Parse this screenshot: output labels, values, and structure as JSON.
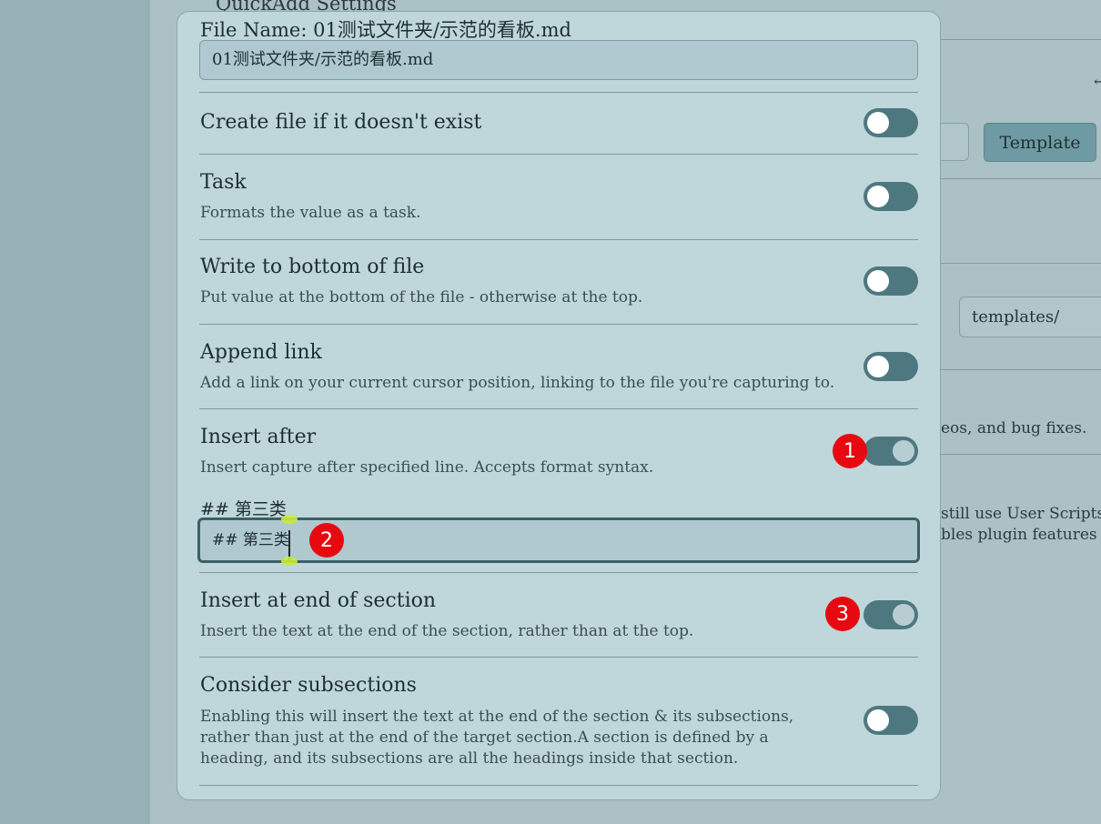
{
  "background": {
    "title": "QuickAdd Settings",
    "template_button": "Template",
    "templates_input_value": "templates/",
    "text_1": "eos, and bug fixes.",
    "text_2": "still use User Scripts",
    "text_3": "bles plugin features",
    "arrow_glyph": "←"
  },
  "modal": {
    "file_name_label": "File Name: 01测试文件夹/示范的看板.md",
    "file_name_value": "01测试文件夹/示范的看板.md",
    "settings": [
      {
        "title": "Create file if it doesn't exist",
        "desc": "",
        "enabled": false
      },
      {
        "title": "Task",
        "desc": "Formats the value as a task.",
        "enabled": false
      },
      {
        "title": "Write to bottom of file",
        "desc": "Put value at the bottom of the file - otherwise at the top.",
        "enabled": false
      },
      {
        "title": "Append link",
        "desc": "Add a link on your current cursor position, linking to the file you're capturing to.",
        "enabled": false
      },
      {
        "title": "Insert after",
        "desc": "Insert capture after specified line. Accepts format syntax.",
        "enabled": true
      },
      {
        "title": "Insert at end of section",
        "desc": "Insert the text at the end of the section, rather than at the top.",
        "enabled": true
      },
      {
        "title": "Consider subsections",
        "desc_lines": [
          "Enabling this will insert the text at the end of the section & its subsections,",
          "rather than just at the end of the target section.A section is defined by a",
          "heading, and its subsections are all the headings inside that section."
        ],
        "enabled": false
      }
    ],
    "insert_after_label": "## 第三类",
    "insert_after_value": "## 第三类"
  },
  "annotations": {
    "badge_1": "1",
    "badge_2": "2",
    "badge_3": "3"
  },
  "colors": {
    "toggle_track": "#4e7880",
    "badge": "#e8080f",
    "modal_bg": "#bfd6da",
    "page_bg": "#aac0c5"
  }
}
